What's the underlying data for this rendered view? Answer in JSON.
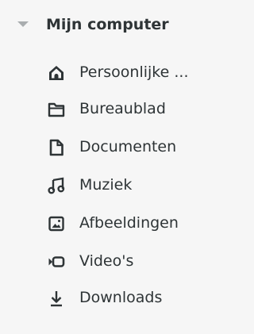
{
  "sidebar": {
    "section": {
      "title": "Mijn computer",
      "expander_icon": "triangle-down-icon",
      "expanded": true
    },
    "items": [
      {
        "label": "Persoonlijke ...",
        "icon": "home-icon"
      },
      {
        "label": "Bureaublad",
        "icon": "folder-icon"
      },
      {
        "label": "Documenten",
        "icon": "document-icon"
      },
      {
        "label": "Muziek",
        "icon": "music-icon"
      },
      {
        "label": "Afbeeldingen",
        "icon": "image-icon"
      },
      {
        "label": "Video's",
        "icon": "video-icon"
      },
      {
        "label": "Downloads",
        "icon": "download-icon"
      }
    ]
  },
  "colors": {
    "background": "#f6f6f6",
    "text": "#2e3436",
    "expander": "#a9adaf"
  }
}
